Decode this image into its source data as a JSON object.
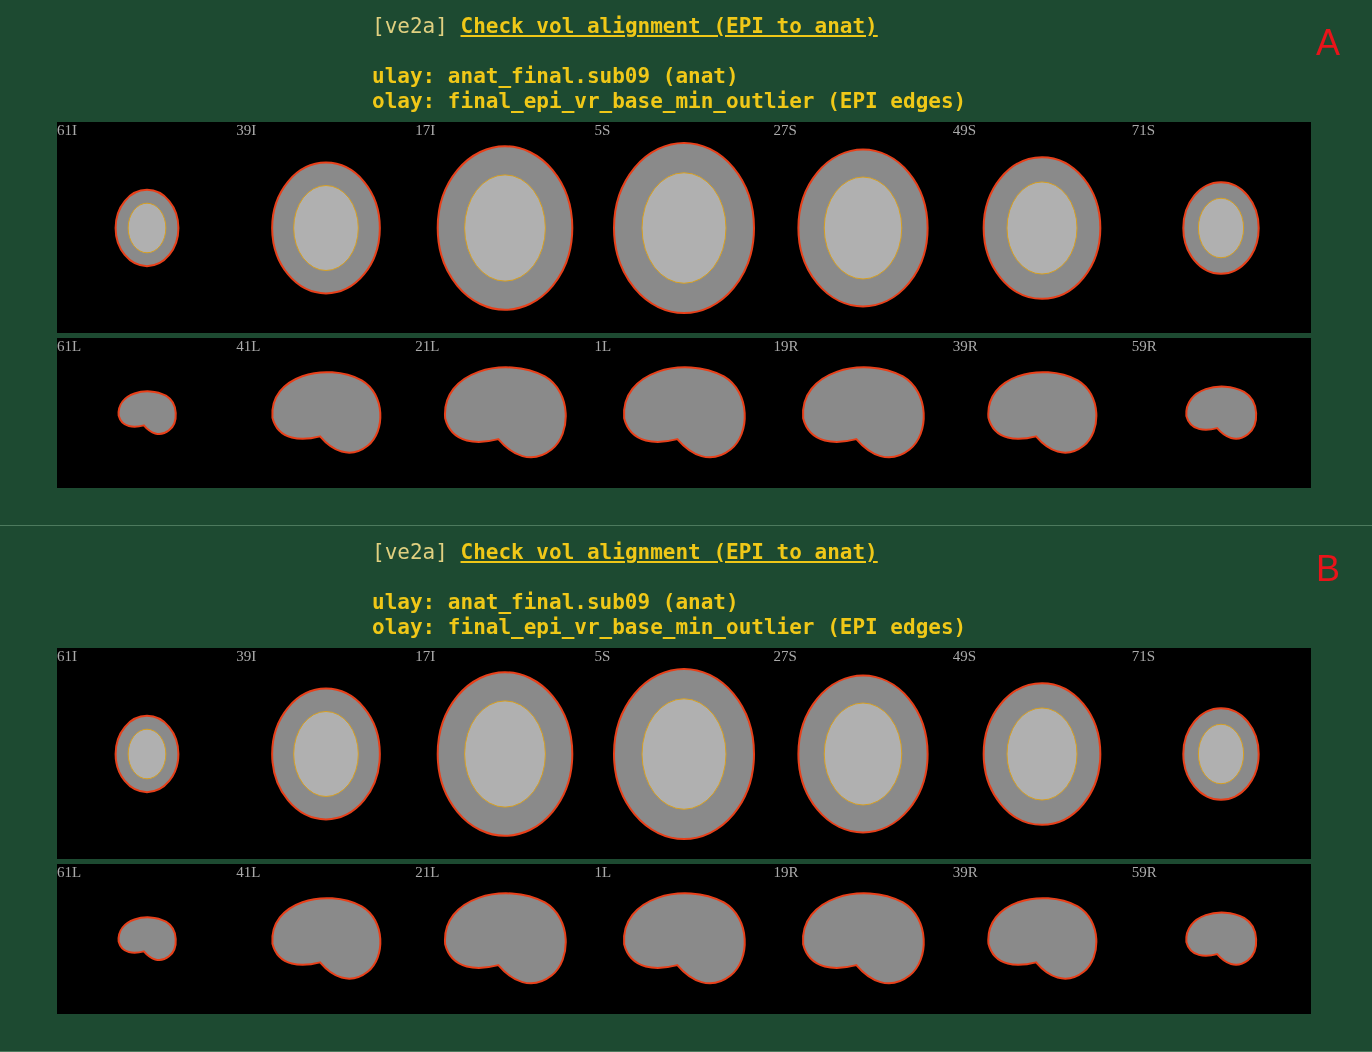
{
  "panels": [
    {
      "letter": "A",
      "tag": "[ve2a]",
      "title": "Check vol alignment (EPI to anat)",
      "lines": [
        "ulay: anat_final.sub09 (anat)",
        "olay: final_epi_vr_base_min_outlier (EPI edges)"
      ],
      "rows": [
        {
          "kind": "axial",
          "slices": [
            "61I",
            "39I",
            "17I",
            "5S",
            "27S",
            "49S",
            "71S"
          ]
        },
        {
          "kind": "sagittal",
          "slices": [
            "61L",
            "41L",
            "21L",
            "1L",
            "19R",
            "39R",
            "59R"
          ]
        }
      ]
    },
    {
      "letter": "B",
      "tag": "[ve2a]",
      "title": "Check vol alignment (EPI to anat)",
      "lines": [
        "ulay: anat_final.sub09 (anat)",
        "olay: final_epi_vr_base_min_outlier (EPI edges)"
      ],
      "rows": [
        {
          "kind": "axial",
          "slices": [
            "61I",
            "39I",
            "17I",
            "5S",
            "27S",
            "49S",
            "71S"
          ]
        },
        {
          "kind": "sagittal",
          "slices": [
            "61L",
            "41L",
            "21L",
            "1L",
            "19R",
            "39R",
            "59R"
          ]
        }
      ]
    }
  ]
}
